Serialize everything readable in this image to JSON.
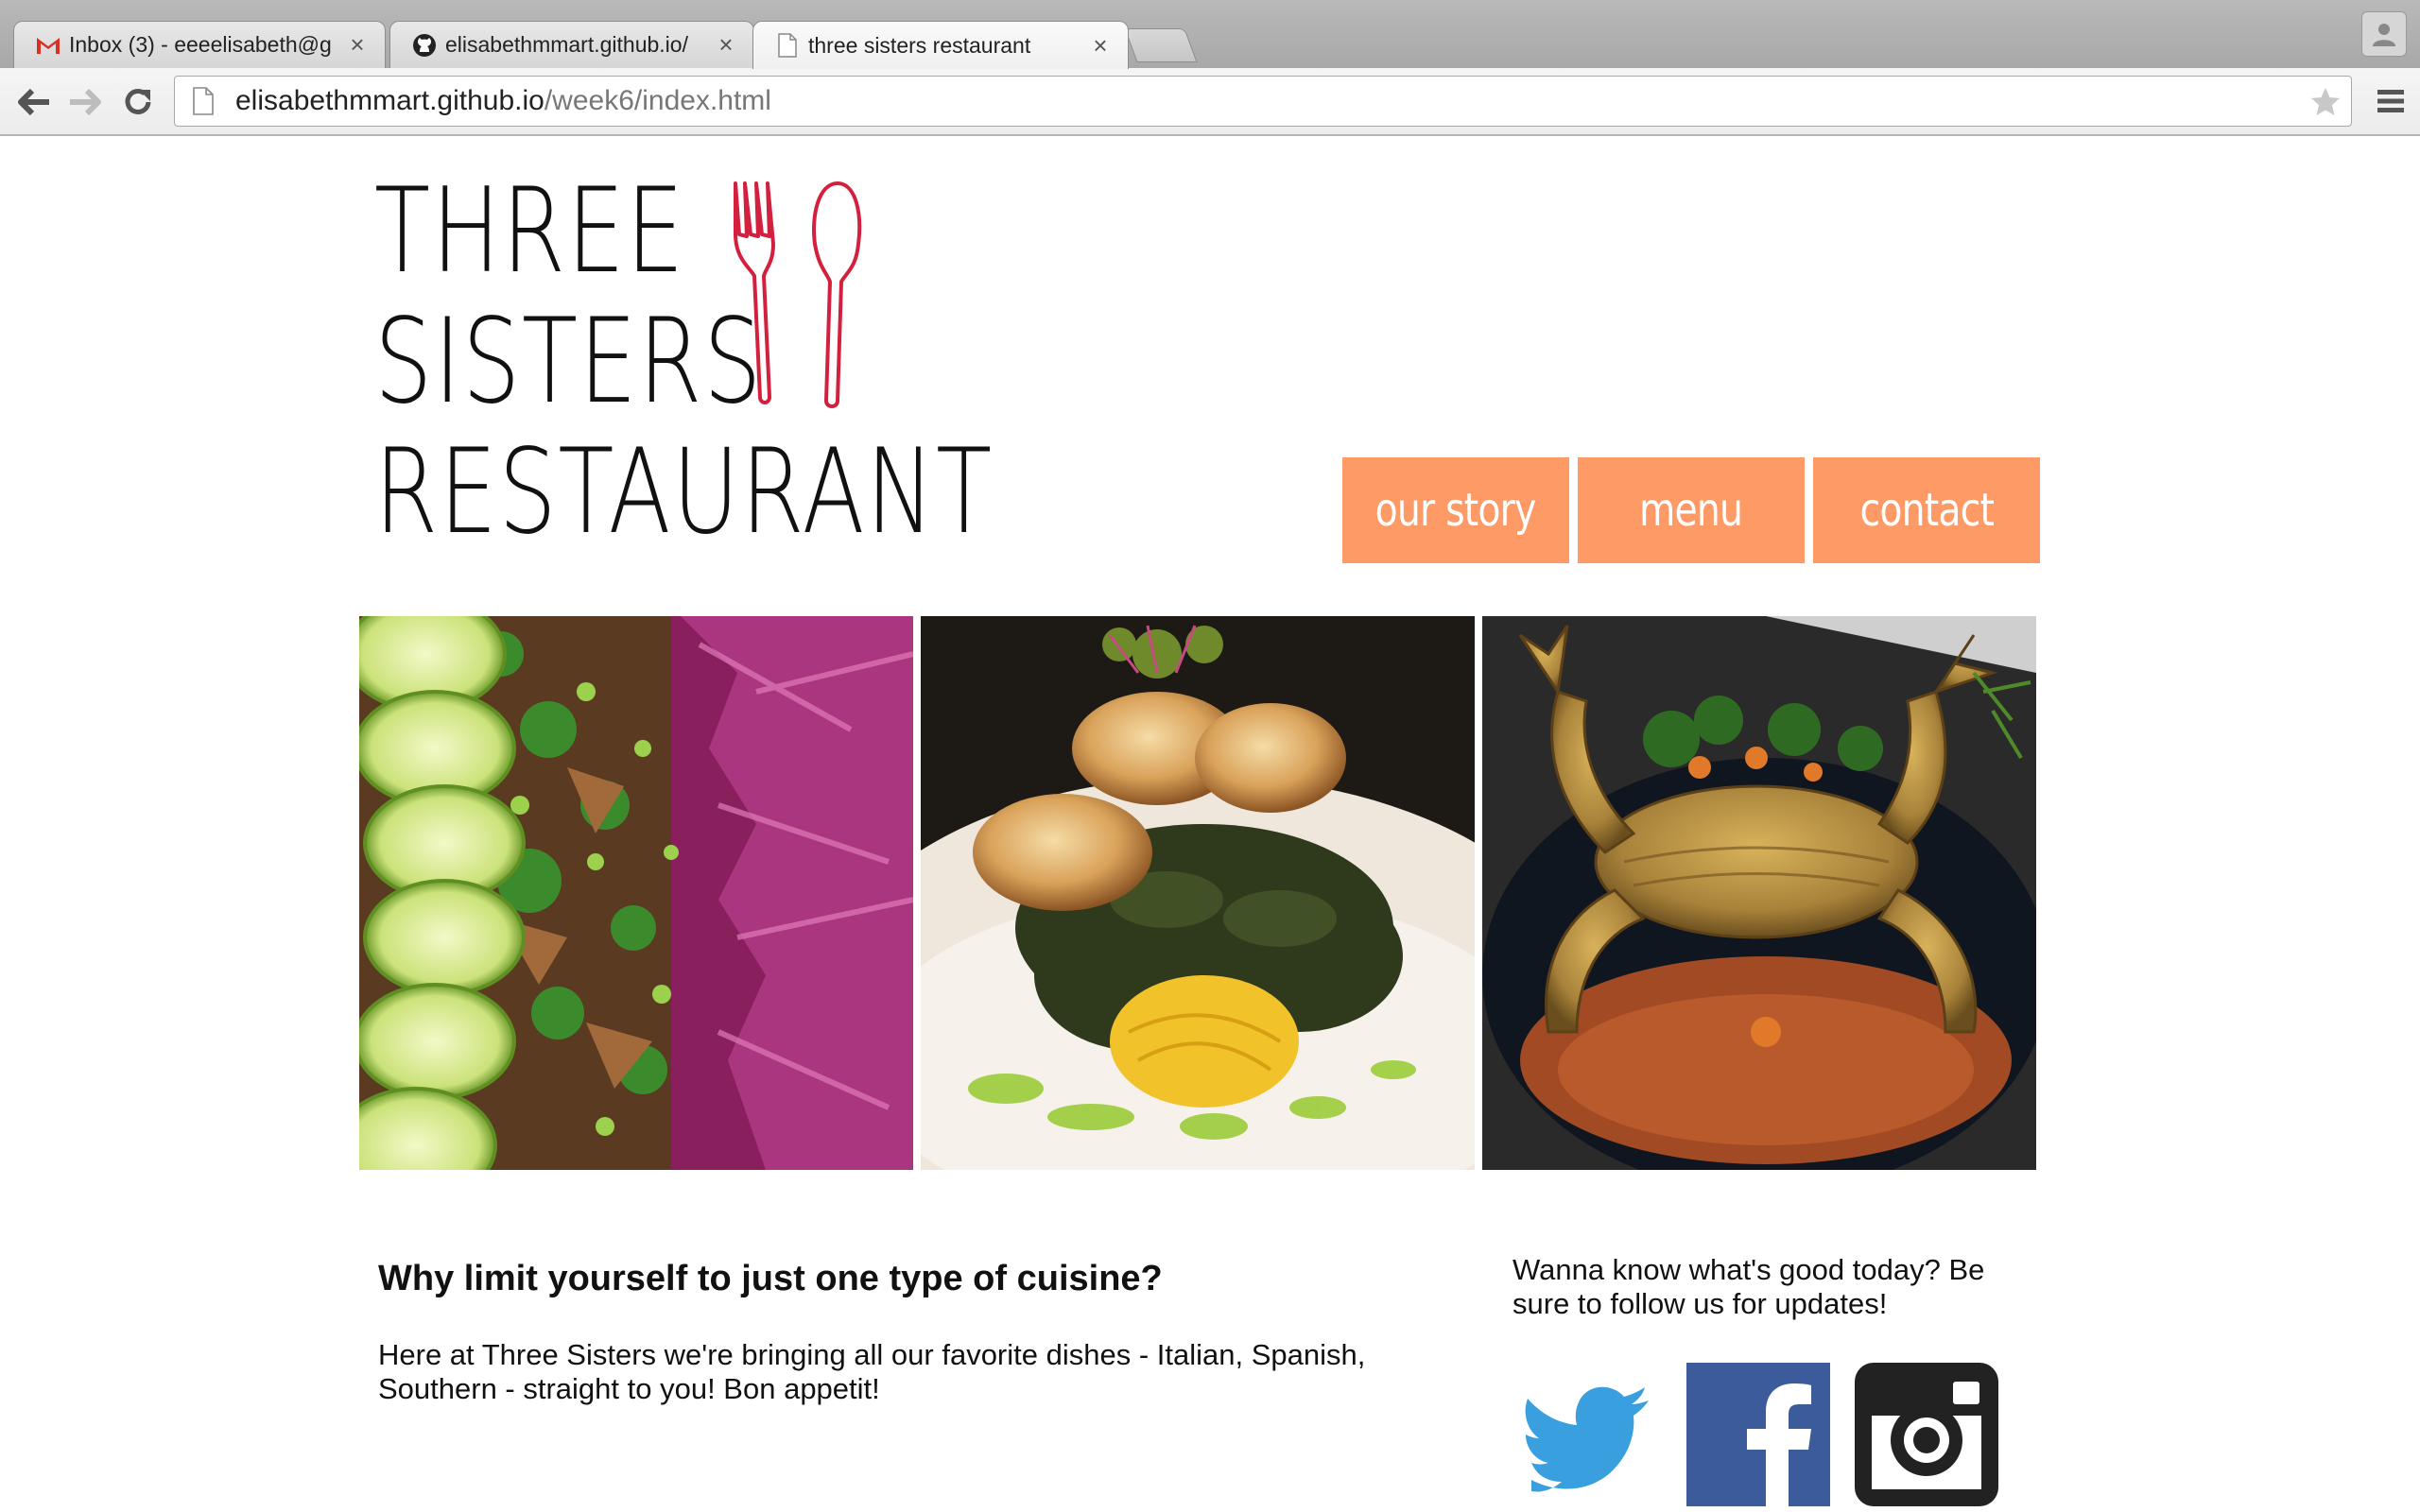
{
  "browser": {
    "tabs": [
      {
        "label": "Inbox (3) - eeeelisabeth@g",
        "favicon": "gmail-icon"
      },
      {
        "label": "elisabethmmart.github.io/",
        "favicon": "github-icon"
      },
      {
        "label": "three sisters restaurant",
        "favicon": "page-icon"
      }
    ],
    "close_glyph": "×",
    "url_host": "elisabethmmart.github.io",
    "url_path": "/week6/index.html"
  },
  "site": {
    "logo_lines": [
      "THREE",
      "SISTERS",
      "RESTAURANT"
    ],
    "nav": [
      "our story",
      "menu",
      "contact"
    ],
    "photos": [
      "salad-photo",
      "scallops-photo",
      "soft-shell-crab-photo"
    ],
    "heading": "Why limit yourself to just one type of cuisine?",
    "intro": "Here at Three Sisters we're bringing all our favorite dishes - Italian, Spanish, Southern - straight to you! Bon appetit!",
    "follow_text": "Wanna know what's good today? Be sure to follow us for updates!",
    "social": [
      "twitter-icon",
      "facebook-icon",
      "instagram-icon"
    ]
  },
  "colors": {
    "nav_bg": "#fd9a65",
    "utensil_red": "#d4203f",
    "twitter": "#3a9fde",
    "facebook": "#3b5b9b",
    "instagram": "#222222"
  }
}
